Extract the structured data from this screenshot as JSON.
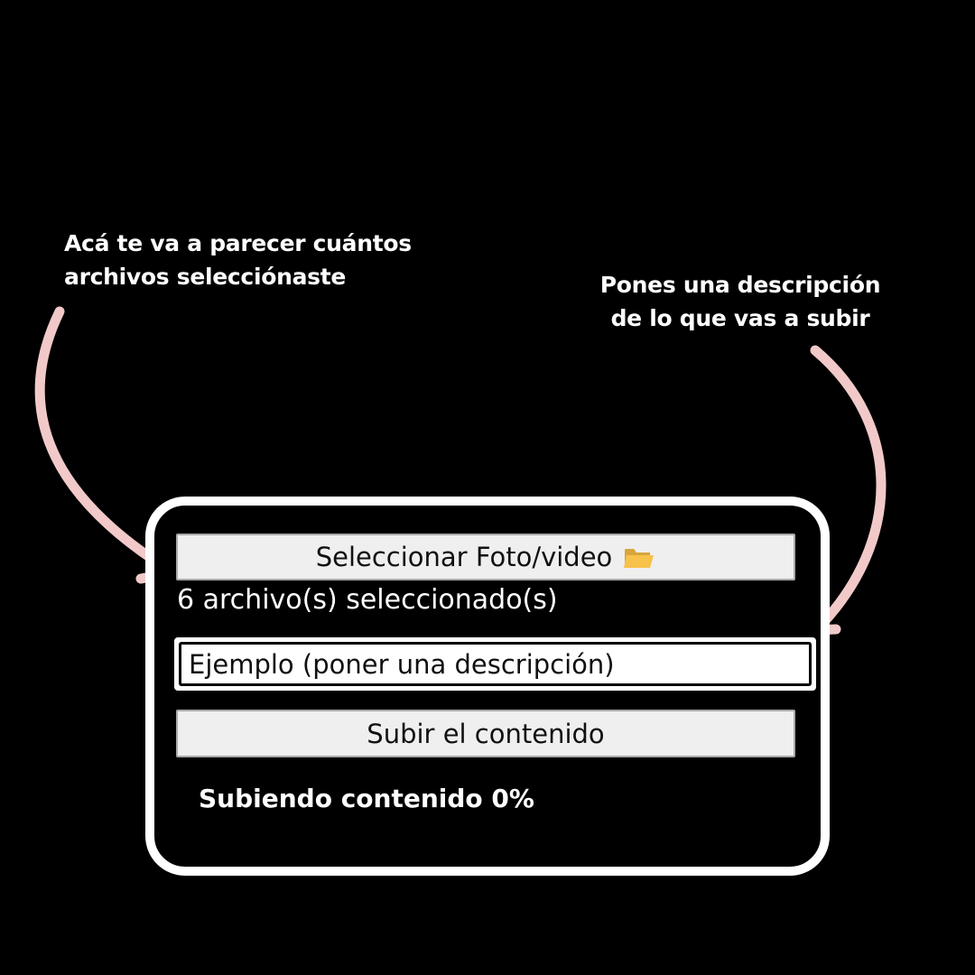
{
  "annotations": {
    "left": {
      "line1": "Acá te va a parecer cuántos",
      "line2": "archivos selecciónaste"
    },
    "right": {
      "line1": "Pones una descripción",
      "line2": "de lo que vas a subir"
    },
    "arrow_color": "#f2c9c9"
  },
  "uploader": {
    "select_button_label": "Seleccionar Foto/video",
    "select_button_icon": "open-folder-icon",
    "file_count_text": "6 archivo(s) seleccionado(s)",
    "description_value": "Ejemplo (poner una descripción)",
    "upload_button_label": "Subir el contenido",
    "progress_text": "Subiendo contenido 0%",
    "progress_percent": 0
  }
}
